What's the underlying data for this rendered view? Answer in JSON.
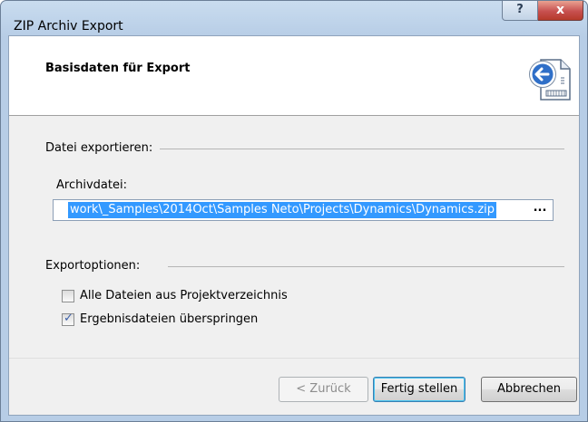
{
  "window": {
    "title": "ZIP Archiv Export",
    "help_label": "?",
    "close_label": "x"
  },
  "header": {
    "title": "Basisdaten für Export",
    "icon": "zip-export-icon"
  },
  "export_section": {
    "label": "Datei exportieren:",
    "field_label": "Archivdatei:",
    "path_value": "work\\_Samples\\2014Oct\\Samples Neto\\Projects\\Dynamics\\Dynamics.zip",
    "browse_label": "..."
  },
  "options_section": {
    "label": "Exportoptionen:",
    "options": [
      {
        "label": "Alle Dateien aus Projektverzeichnis",
        "checked": false
      },
      {
        "label": "Ergebnisdateien überspringen",
        "checked": true
      }
    ]
  },
  "buttons": {
    "back": "< Zurück",
    "finish": "Fertig stellen",
    "cancel": "Abbrechen"
  },
  "colors": {
    "selection": "#3399ff",
    "titlebar": "#c9dcef",
    "close": "#c75050"
  }
}
